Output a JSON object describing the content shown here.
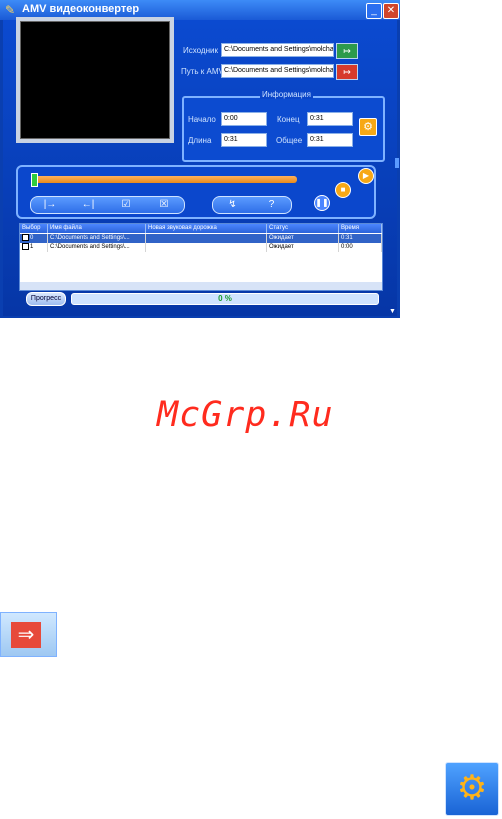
{
  "window": {
    "title": "AMV видеоконвертер",
    "icons": {
      "app": "app-icon",
      "minimize": "minimize-icon",
      "close": "close-icon"
    }
  },
  "paths": {
    "source_label": "Исходник",
    "source_value": "C:\\Documents and Settings\\molchan",
    "output_label": "Путь к AMV",
    "output_value": "C:\\Documents and Settings\\molchan"
  },
  "info": {
    "title": "Информация",
    "start_label": "Начало",
    "start_value": "0:00",
    "end_label": "Конец",
    "end_value": "0:31",
    "length_label": "Длина",
    "length_value": "0:31",
    "total_label": "Общее",
    "total_value": "0:31"
  },
  "controls": {
    "group1": [
      "|→",
      "←|",
      "☑",
      "☒"
    ],
    "group2": [
      "↯",
      "?"
    ],
    "play_icon": "play-icon",
    "stop_icon": "stop-icon",
    "pause_icon": "pause-icon"
  },
  "table": {
    "headers": [
      "Выбор",
      "Имя файла",
      "Новая звуковая дорожка",
      "Статус",
      "Время"
    ],
    "rows": [
      {
        "index": "0",
        "file": "C:\\Documents and Settings\\...",
        "track": "",
        "status": "Ожидает",
        "time": "0:31",
        "selected": true,
        "checked": true
      },
      {
        "index": "1",
        "file": "C:\\Documents and Settings\\...",
        "track": "",
        "status": "Ожидает",
        "time": "0:00",
        "selected": false,
        "checked": false
      }
    ]
  },
  "progress": {
    "button_label": "Прогресс",
    "value_text": "0 %",
    "percent": 0
  },
  "watermark": "McGrp.Ru",
  "colors": {
    "accent": "#0a3fb0",
    "seek": "#ff9f3a",
    "close": "#d0452b",
    "watermark": "#ff2b1e"
  }
}
